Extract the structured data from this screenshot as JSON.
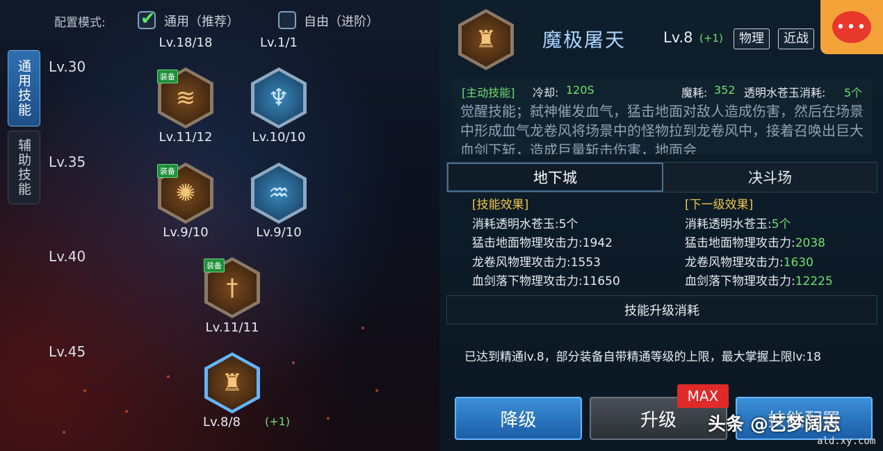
{
  "config": {
    "label": "配置模式:",
    "options": [
      {
        "label": "通用（推荐）",
        "checked": true
      },
      {
        "label": "自由（进阶）",
        "checked": false
      }
    ]
  },
  "side_tabs": [
    {
      "label": "通用技能",
      "active": true
    },
    {
      "label": "辅助技能",
      "active": false
    }
  ],
  "tree": {
    "top_levels": [
      "Lv.18/18",
      "Lv.1/1"
    ],
    "rows": [
      {
        "label": "Lv.30"
      },
      {
        "label": "Lv.35"
      },
      {
        "label": "Lv.40"
      },
      {
        "label": "Lv.45"
      }
    ],
    "skills": [
      {
        "icon": "claw-slash-icon",
        "level": "Lv.11/12",
        "equipped": true,
        "equip_label": "装备",
        "style": "gold"
      },
      {
        "icon": "figure-aura-icon",
        "level": "Lv.10/10",
        "equipped": false,
        "style": "blue"
      },
      {
        "icon": "explosion-icon",
        "level": "Lv.9/10",
        "equipped": true,
        "equip_label": "装备",
        "style": "gold"
      },
      {
        "icon": "wind-spiral-icon",
        "level": "Lv.9/10",
        "equipped": false,
        "style": "blue"
      },
      {
        "icon": "sword-vortex-icon",
        "level": "Lv.11/11",
        "equipped": true,
        "equip_label": "装备",
        "style": "gold"
      },
      {
        "icon": "chained-figure-icon",
        "level": "Lv.8/8",
        "bonus": "(+1)",
        "equipped": false,
        "style": "gold",
        "selected": true
      }
    ]
  },
  "skill": {
    "icon": "chained-figure-icon",
    "name": "魔极屠天",
    "level": "Lv.8",
    "bonus": "(+1)",
    "tags": [
      "物理",
      "近战"
    ],
    "type": "[主动技能]",
    "cooldown_label": "冷却:",
    "cooldown": "120S",
    "mp_label": "魔耗:",
    "mp": "352",
    "material_label": "透明水苍玉消耗:",
    "material": "5个",
    "description": "觉醒技能；弑神催发血气，猛击地面对敌人造成伤害，然后在场景中形成血气龙卷风将场景中的怪物拉到龙卷风中，接着召唤出巨大血剑下斩，造成巨量斩击伤害，地面会"
  },
  "mode_tabs": [
    {
      "label": "地下城",
      "active": true
    },
    {
      "label": "决斗场",
      "active": false
    }
  ],
  "effects": {
    "current_title": "[技能效果]",
    "next_title": "[下一级效果]",
    "current": [
      {
        "label": "消耗透明水苍玉:",
        "value": "5个"
      },
      {
        "label": "猛击地面物理攻击力:",
        "value": "1942"
      },
      {
        "label": "龙卷风物理攻击力:",
        "value": "1553"
      },
      {
        "label": "血剑落下物理攻击力:",
        "value": "11650"
      }
    ],
    "next": [
      {
        "label": "消耗透明水苍玉:",
        "value": "5个"
      },
      {
        "label": "猛击地面物理攻击力:",
        "value": "2038"
      },
      {
        "label": "龙卷风物理攻击力:",
        "value": "1630"
      },
      {
        "label": "血剑落下物理攻击力:",
        "value": "12225"
      }
    ]
  },
  "cost_title": "技能升级消耗",
  "notice": "已达到精通lv.8，部分装备自带精通等级的上限，最大掌握上限lv:18",
  "buttons": {
    "downgrade": "降级",
    "upgrade": "升级",
    "max_badge": "MAX",
    "configure": "技能配置"
  },
  "watermark": {
    "text": "头条 @艺梦阔志",
    "url": "ald.xy.com"
  },
  "colors": {
    "accent_green": "#6fe06f",
    "accent_gold": "#f0c64a",
    "title_blue": "#a9d4ff",
    "max_red": "#e02a2a"
  }
}
